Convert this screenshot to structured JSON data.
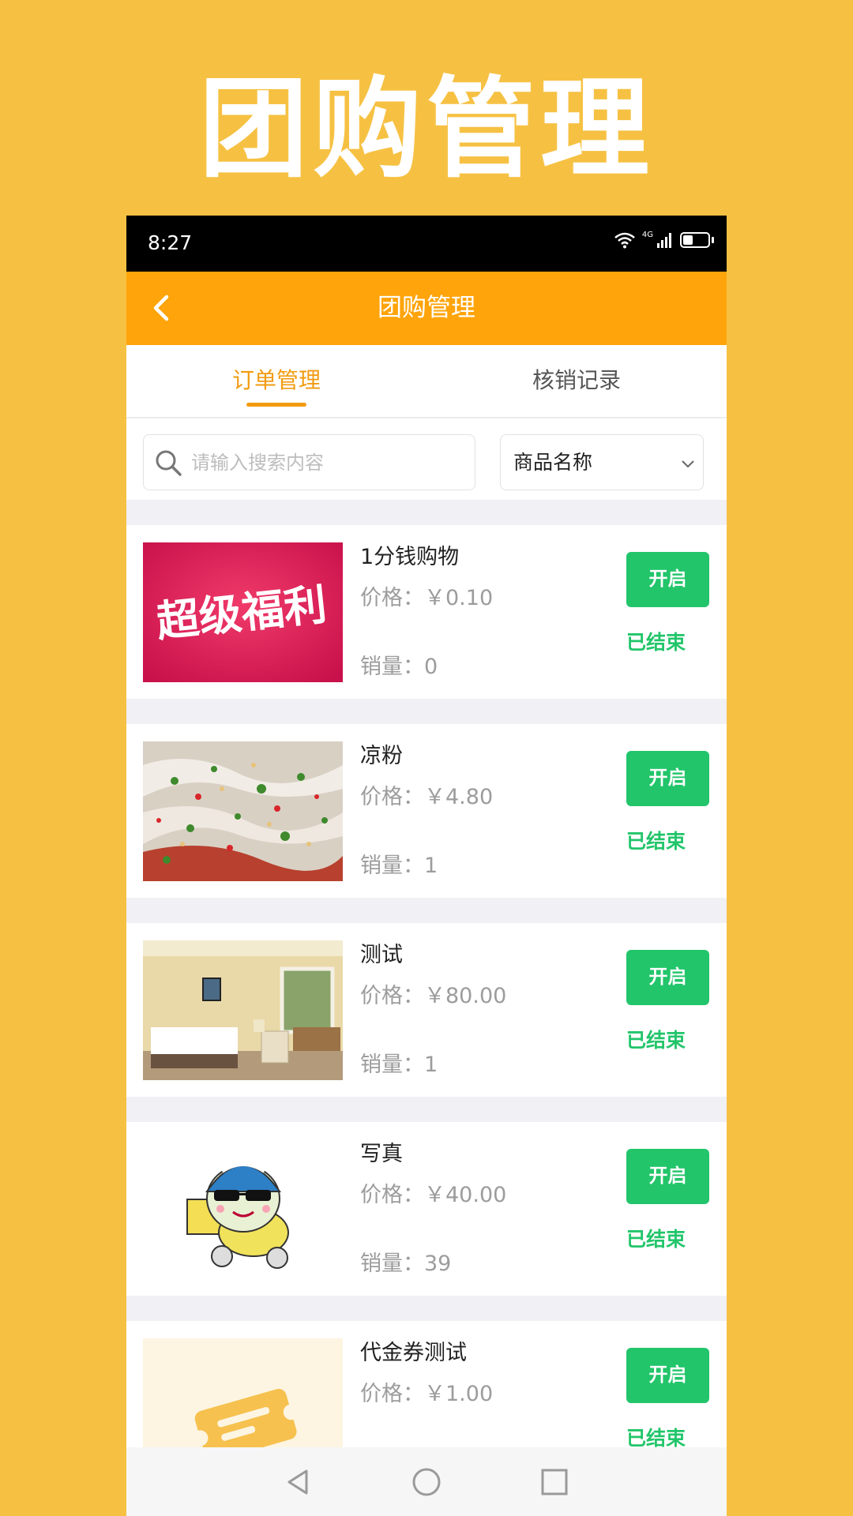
{
  "hero": {
    "title": "团购管理"
  },
  "status_bar": {
    "time": "8:27",
    "network_label": "4G",
    "battery_level": 0.4
  },
  "header": {
    "title": "团购管理"
  },
  "tabs": [
    {
      "label": "订单管理",
      "active": true
    },
    {
      "label": "核销记录",
      "active": false
    }
  ],
  "search": {
    "placeholder": "请输入搜索内容",
    "value": "",
    "filter_selected": "商品名称"
  },
  "items": [
    {
      "name": "1分钱购物",
      "price": "价格：￥0.10",
      "sales": "销量：0",
      "button": "开启",
      "status": "已结束",
      "thumb_text": "超级福利"
    },
    {
      "name": "凉粉",
      "price": "价格：￥4.80",
      "sales": "销量：1",
      "button": "开启",
      "status": "已结束"
    },
    {
      "name": "测试",
      "price": "价格：￥80.00",
      "sales": "销量：1",
      "button": "开启",
      "status": "已结束"
    },
    {
      "name": "写真",
      "price": "价格：￥40.00",
      "sales": "销量：39",
      "button": "开启",
      "status": "已结束"
    },
    {
      "name": "代金券测试",
      "price": "价格：￥1.00",
      "sales": "",
      "button": "开启",
      "status": "已结束"
    }
  ],
  "colors": {
    "page_bg": "#F6C143",
    "header": "#FFA40A",
    "tab_active": "#F29B10",
    "green": "#22C56A"
  },
  "icons": {
    "back": "chevron-left-icon",
    "search": "search-icon",
    "dropdown": "chevron-down-icon"
  }
}
